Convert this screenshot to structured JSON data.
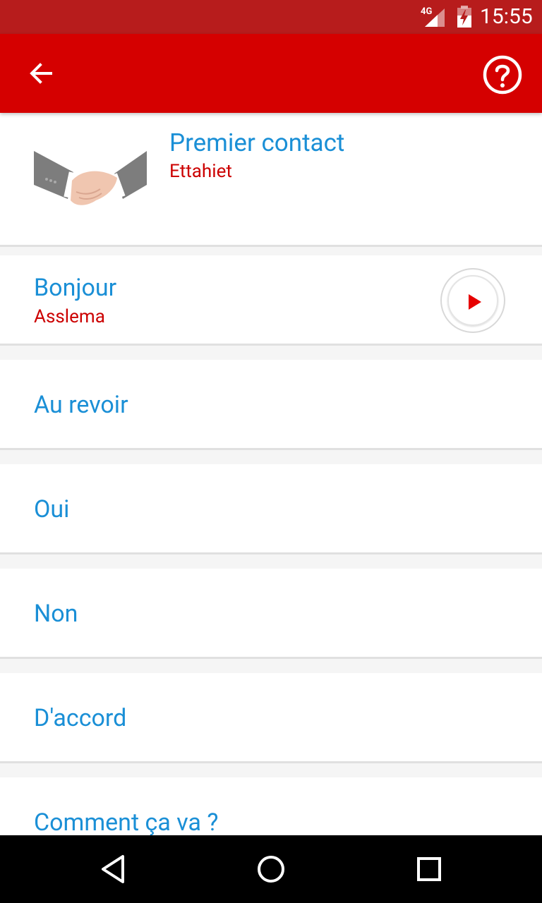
{
  "status_bar": {
    "network": "4G",
    "time": "15:55"
  },
  "app_bar": {
    "back_icon": "arrow-back-icon",
    "help_icon": "help-circle-icon"
  },
  "header": {
    "title": "Premier contact",
    "subtitle": "Ettahiet",
    "image": "handshake-illustration"
  },
  "phrases": [
    {
      "label": "Bonjour",
      "translation": "Asslema",
      "has_play": true
    },
    {
      "label": "Au revoir"
    },
    {
      "label": "Oui"
    },
    {
      "label": "Non"
    },
    {
      "label": "D'accord"
    },
    {
      "label": "Comment ça va ?"
    }
  ],
  "colors": {
    "status_bar": "#b71c1c",
    "app_bar": "#d50000",
    "label_blue": "#1a8fd6",
    "translation_red": "#cc0000"
  },
  "nav_bar": {
    "icons": [
      "back-triangle-icon",
      "home-circle-icon",
      "recents-square-icon"
    ]
  }
}
